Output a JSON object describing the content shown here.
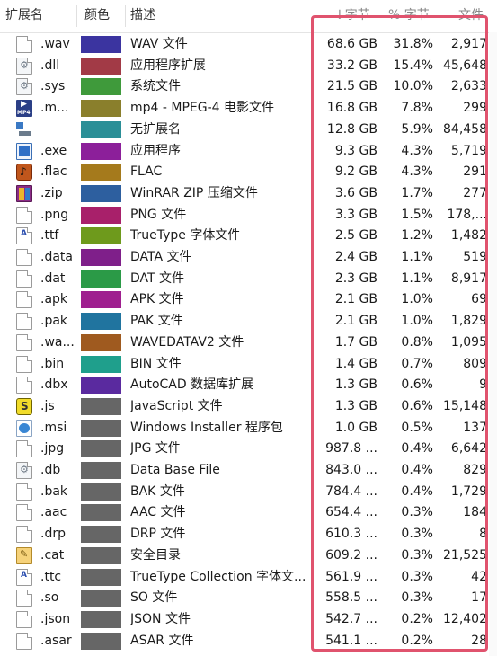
{
  "header": {
    "col_extension": "扩展名",
    "col_color": "颜色",
    "col_description": "描述",
    "col_bytes": "↓字节",
    "col_percent": "% 字节",
    "col_files": "文件"
  },
  "rows": [
    {
      "ext": ".wav",
      "icon": "document-icon",
      "color": "#3b34a0",
      "desc": "WAV 文件",
      "bytes": "68.6 GB",
      "pct": "31.8%",
      "files": "2,917"
    },
    {
      "ext": ".dll",
      "icon": "dll-gear-icon",
      "color": "#a23a46",
      "desc": "应用程序扩展",
      "bytes": "33.2 GB",
      "pct": "15.4%",
      "files": "45,648"
    },
    {
      "ext": ".sys",
      "icon": "sys-gear-icon",
      "color": "#3f9a3b",
      "desc": "系统文件",
      "bytes": "21.5 GB",
      "pct": "10.0%",
      "files": "2,633"
    },
    {
      "ext": ".m...",
      "icon": "mp4-icon",
      "color": "#8a7f2c",
      "desc": "mp4 - MPEG-4 电影文件",
      "bytes": "16.8 GB",
      "pct": "7.8%",
      "files": "299"
    },
    {
      "ext": "",
      "icon": "no-extension-icon",
      "color": "#2b8f97",
      "desc": "无扩展名",
      "bytes": "12.8 GB",
      "pct": "5.9%",
      "files": "84,458"
    },
    {
      "ext": ".exe",
      "icon": "exe-icon",
      "color": "#8c1f9a",
      "desc": "应用程序",
      "bytes": "9.3 GB",
      "pct": "4.3%",
      "files": "5,719"
    },
    {
      "ext": ".flac",
      "icon": "flac-icon",
      "color": "#a57a1c",
      "desc": "FLAC",
      "bytes": "9.2 GB",
      "pct": "4.3%",
      "files": "291"
    },
    {
      "ext": ".zip",
      "icon": "winrar-zip-icon",
      "color": "#2d5f9f",
      "desc": "WinRAR ZIP 压缩文件",
      "bytes": "3.6 GB",
      "pct": "1.7%",
      "files": "277"
    },
    {
      "ext": ".png",
      "icon": "document-icon",
      "color": "#a8206a",
      "desc": "PNG 文件",
      "bytes": "3.3 GB",
      "pct": "1.5%",
      "files": "178,..."
    },
    {
      "ext": ".ttf",
      "icon": "font-icon",
      "color": "#6e9a1c",
      "desc": "TrueType 字体文件",
      "bytes": "2.5 GB",
      "pct": "1.2%",
      "files": "1,482"
    },
    {
      "ext": ".data",
      "icon": "document-icon",
      "color": "#7f1f8a",
      "desc": "DATA 文件",
      "bytes": "2.4 GB",
      "pct": "1.1%",
      "files": "519"
    },
    {
      "ext": ".dat",
      "icon": "document-icon",
      "color": "#2b9a47",
      "desc": "DAT 文件",
      "bytes": "2.3 GB",
      "pct": "1.1%",
      "files": "8,917"
    },
    {
      "ext": ".apk",
      "icon": "document-icon",
      "color": "#9f1f8f",
      "desc": "APK 文件",
      "bytes": "2.1 GB",
      "pct": "1.0%",
      "files": "69"
    },
    {
      "ext": ".pak",
      "icon": "document-icon",
      "color": "#20749f",
      "desc": "PAK 文件",
      "bytes": "2.1 GB",
      "pct": "1.0%",
      "files": "1,829"
    },
    {
      "ext": ".wa...",
      "icon": "document-icon",
      "color": "#9f5a1f",
      "desc": "WAVEDATAV2 文件",
      "bytes": "1.7 GB",
      "pct": "0.8%",
      "files": "1,095"
    },
    {
      "ext": ".bin",
      "icon": "document-icon",
      "color": "#1f9f8c",
      "desc": "BIN 文件",
      "bytes": "1.4 GB",
      "pct": "0.7%",
      "files": "809"
    },
    {
      "ext": ".dbx",
      "icon": "document-icon",
      "color": "#5a2a9f",
      "desc": "AutoCAD 数据库扩展",
      "bytes": "1.3 GB",
      "pct": "0.6%",
      "files": "9"
    },
    {
      "ext": ".js",
      "icon": "javascript-icon",
      "color": "#666666",
      "desc": "JavaScript 文件",
      "bytes": "1.3 GB",
      "pct": "0.6%",
      "files": "15,148"
    },
    {
      "ext": ".msi",
      "icon": "windows-installer-icon",
      "color": "#666666",
      "desc": "Windows Installer 程序包",
      "bytes": "1.0 GB",
      "pct": "0.5%",
      "files": "137"
    },
    {
      "ext": ".jpg",
      "icon": "document-icon",
      "color": "#666666",
      "desc": "JPG 文件",
      "bytes": "987.8 ...",
      "pct": "0.4%",
      "files": "6,642"
    },
    {
      "ext": ".db",
      "icon": "database-gear-icon",
      "color": "#666666",
      "desc": "Data Base File",
      "bytes": "843.0 ...",
      "pct": "0.4%",
      "files": "829"
    },
    {
      "ext": ".bak",
      "icon": "document-icon",
      "color": "#666666",
      "desc": "BAK 文件",
      "bytes": "784.4 ...",
      "pct": "0.4%",
      "files": "1,729"
    },
    {
      "ext": ".aac",
      "icon": "document-icon",
      "color": "#666666",
      "desc": "AAC 文件",
      "bytes": "654.4 ...",
      "pct": "0.3%",
      "files": "184"
    },
    {
      "ext": ".drp",
      "icon": "document-icon",
      "color": "#666666",
      "desc": "DRP 文件",
      "bytes": "610.3 ...",
      "pct": "0.3%",
      "files": "8"
    },
    {
      "ext": ".cat",
      "icon": "security-catalog-icon",
      "color": "#666666",
      "desc": "安全目录",
      "bytes": "609.2 ...",
      "pct": "0.3%",
      "files": "21,525"
    },
    {
      "ext": ".ttc",
      "icon": "font-icon",
      "color": "#666666",
      "desc": "TrueType Collection 字体文...",
      "bytes": "561.9 ...",
      "pct": "0.3%",
      "files": "42"
    },
    {
      "ext": ".so",
      "icon": "document-icon",
      "color": "#666666",
      "desc": "SO 文件",
      "bytes": "558.5 ...",
      "pct": "0.3%",
      "files": "17"
    },
    {
      "ext": ".json",
      "icon": "document-icon",
      "color": "#666666",
      "desc": "JSON 文件",
      "bytes": "542.7 ...",
      "pct": "0.2%",
      "files": "12,402"
    },
    {
      "ext": ".asar",
      "icon": "document-icon",
      "color": "#666666",
      "desc": "ASAR 文件",
      "bytes": "541.1 ...",
      "pct": "0.2%",
      "files": "28"
    }
  ],
  "highlight_color": "#e0536e"
}
